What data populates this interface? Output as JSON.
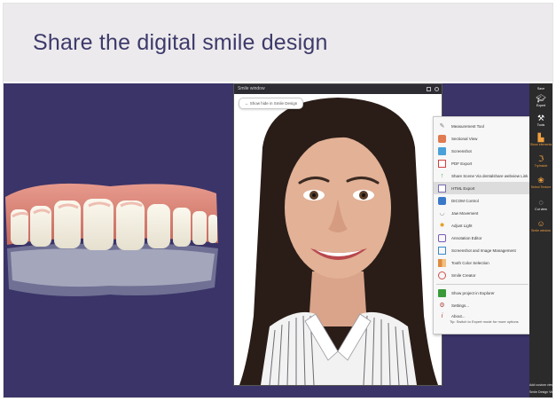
{
  "slide": {
    "title": "Share the digital smile design"
  },
  "smile_window": {
    "title": "Smile window",
    "show_button_label": "← Show hide in Smile Design"
  },
  "context_menu": {
    "items": [
      {
        "label": "Measurement Tool",
        "icon": "ruler-icon"
      },
      {
        "label": "Sectional View",
        "icon": "section-icon"
      },
      {
        "label": "Screenshot",
        "icon": "camera-icon"
      },
      {
        "label": "PDF Export",
        "icon": "pdf-icon"
      },
      {
        "label": "Share Scene Via dentalshare webview Link",
        "icon": "share-icon"
      },
      {
        "label": "HTML Export",
        "icon": "html-icon",
        "selected": true
      },
      {
        "label": "DICOM Control",
        "icon": "dicom-icon"
      },
      {
        "label": "Jaw Movement",
        "icon": "jaw-icon"
      },
      {
        "label": "Adjust Light",
        "icon": "light-icon"
      },
      {
        "label": "Annotation Editor",
        "icon": "annotation-icon"
      },
      {
        "label": "Screenshot and Image Management",
        "icon": "image-manage-icon"
      },
      {
        "label": "Tooth Color Selection",
        "icon": "palette-icon"
      },
      {
        "label": "Smile Creator",
        "icon": "smile-icon"
      },
      {
        "label": "Show project in Explorer",
        "icon": "folder-icon"
      },
      {
        "label": "Settings...",
        "icon": "settings-icon"
      },
      {
        "label": "About...",
        "icon": "info-icon"
      }
    ],
    "tip": "Tip: Switch to Expert mode for more options"
  },
  "toolbar": {
    "save": "Save",
    "expert": "Expert",
    "tools": "Tools",
    "show_elements": "Show elements",
    "tryinside": "TryInside",
    "select_texture": "Select Texture",
    "cut_view": "Cut view",
    "smile_window": "Smile window",
    "add_custom_view": "Add custom view",
    "smile_design_view": "Smile Design View",
    "accent_color": "#f0a040"
  }
}
